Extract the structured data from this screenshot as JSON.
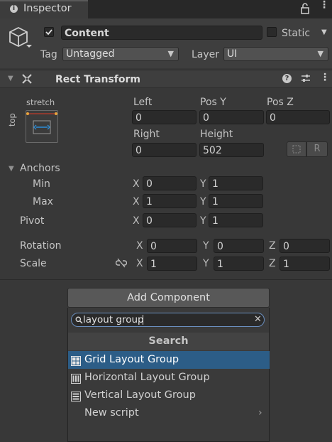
{
  "tab": {
    "label": "Inspector",
    "lock_icon": "lock-icon",
    "menu_icon": "kebab-menu-icon"
  },
  "object": {
    "name": "Content",
    "active": true,
    "static_label": "Static",
    "tag_label": "Tag",
    "tag_value": "Untagged",
    "layer_label": "Layer",
    "layer_value": "UI"
  },
  "rect_transform": {
    "title": "Rect Transform",
    "anchor_preset_h": "stretch",
    "anchor_preset_v": "top",
    "labels": {
      "left": "Left",
      "pos_y": "Pos Y",
      "pos_z": "Pos Z",
      "right": "Right",
      "height": "Height"
    },
    "values": {
      "left": "0",
      "pos_y": "0",
      "pos_z": "0",
      "right": "0",
      "height": "502"
    },
    "raw_button": "R",
    "anchors_label": "Anchors",
    "min_label": "Min",
    "max_label": "Max",
    "pivot_label": "Pivot",
    "rotation_label": "Rotation",
    "scale_label": "Scale",
    "axis": {
      "x": "X",
      "y": "Y",
      "z": "Z"
    },
    "anchors_min": {
      "x": "0",
      "y": "1"
    },
    "anchors_max": {
      "x": "1",
      "y": "1"
    },
    "pivot": {
      "x": "0",
      "y": "1"
    },
    "rotation": {
      "x": "0",
      "y": "0",
      "z": "0"
    },
    "scale": {
      "x": "1",
      "y": "1",
      "z": "1"
    }
  },
  "add_component": {
    "button_label": "Add Component",
    "search_value": "layout group",
    "header": "Search",
    "items": [
      {
        "label": "Grid Layout Group",
        "icon": "grid-layout-icon",
        "selected": true
      },
      {
        "label": "Horizontal Layout Group",
        "icon": "horizontal-layout-icon",
        "selected": false
      },
      {
        "label": "Vertical Layout Group",
        "icon": "vertical-layout-icon",
        "selected": false
      },
      {
        "label": "New script",
        "icon": "",
        "selected": false
      }
    ]
  },
  "colors": {
    "panel": "#383838",
    "header": "#3e3e3e",
    "tab_bar": "#282828",
    "selection": "#2c5d87",
    "field": "#2a2a2a"
  }
}
